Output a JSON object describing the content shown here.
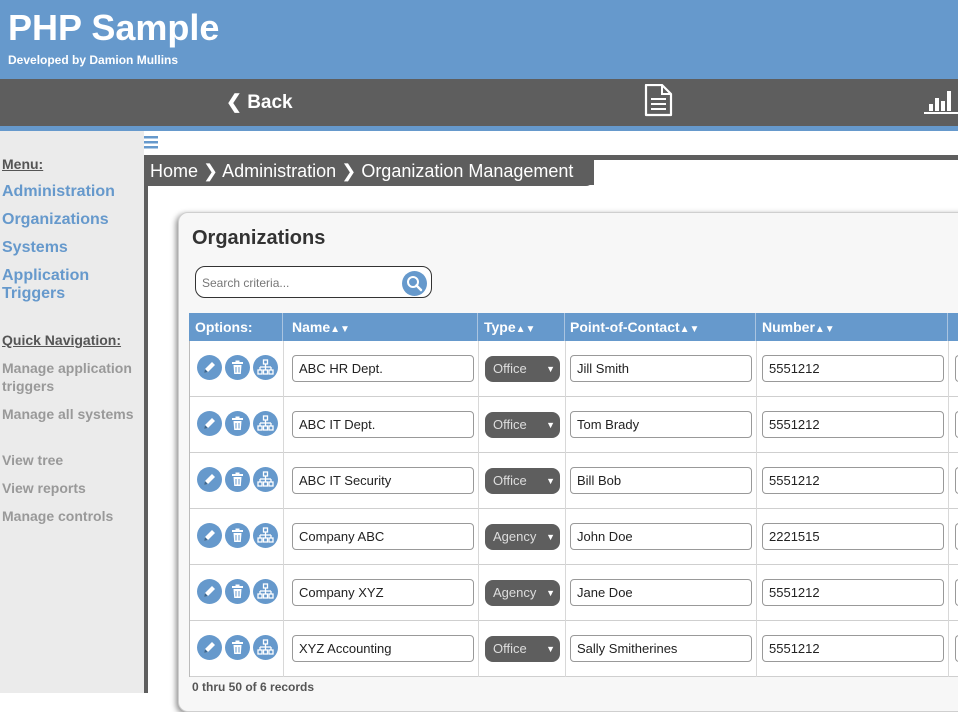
{
  "header": {
    "title": "PHP Sample",
    "subtitle": "Developed by Damion Mullins"
  },
  "navbar": {
    "back_label": "❮ Back",
    "doc_icon": "document-icon",
    "chart_icon": "bar-chart-icon"
  },
  "sidebar": {
    "menu_heading": "Menu:",
    "menu_items": [
      {
        "label": "Administration"
      },
      {
        "label": "Organizations"
      },
      {
        "label": "Systems"
      },
      {
        "label": "Application Triggers"
      }
    ],
    "quick_heading": "Quick Navigation:",
    "quick_items": [
      {
        "label": "Manage application triggers"
      },
      {
        "label": "Manage all systems"
      },
      {
        "label": "View tree"
      },
      {
        "label": "View reports"
      },
      {
        "label": "Manage controls"
      }
    ]
  },
  "breadcrumb": {
    "items": [
      "Home",
      "Administration",
      "Organization Management"
    ],
    "separator": "❯"
  },
  "panel": {
    "title": "Organizations",
    "search_placeholder": "Search criteria..."
  },
  "table": {
    "sort_glyph": "▲▼",
    "columns": [
      {
        "label": "Options:"
      },
      {
        "label": "Name"
      },
      {
        "label": "Type"
      },
      {
        "label": "Point-of-Contact"
      },
      {
        "label": "Number"
      }
    ],
    "rows": [
      {
        "name": "ABC HR Dept.",
        "type": "Office",
        "contact": "Jill Smith",
        "number": "5551212"
      },
      {
        "name": "ABC IT Dept.",
        "type": "Office",
        "contact": "Tom Brady",
        "number": "5551212"
      },
      {
        "name": "ABC IT Security",
        "type": "Office",
        "contact": "Bill Bob",
        "number": "5551212"
      },
      {
        "name": "Company ABC",
        "type": "Agency",
        "contact": "John Doe",
        "number": "2221515"
      },
      {
        "name": "Company XYZ",
        "type": "Agency",
        "contact": "Jane Doe",
        "number": "5551212"
      },
      {
        "name": "XYZ Accounting",
        "type": "Office",
        "contact": "Sally Smitherines",
        "number": "5551212"
      }
    ],
    "records_summary": "0 thru 50 of 6 records"
  },
  "colors": {
    "accent": "#6699cc",
    "dark": "#5e5e5e"
  }
}
